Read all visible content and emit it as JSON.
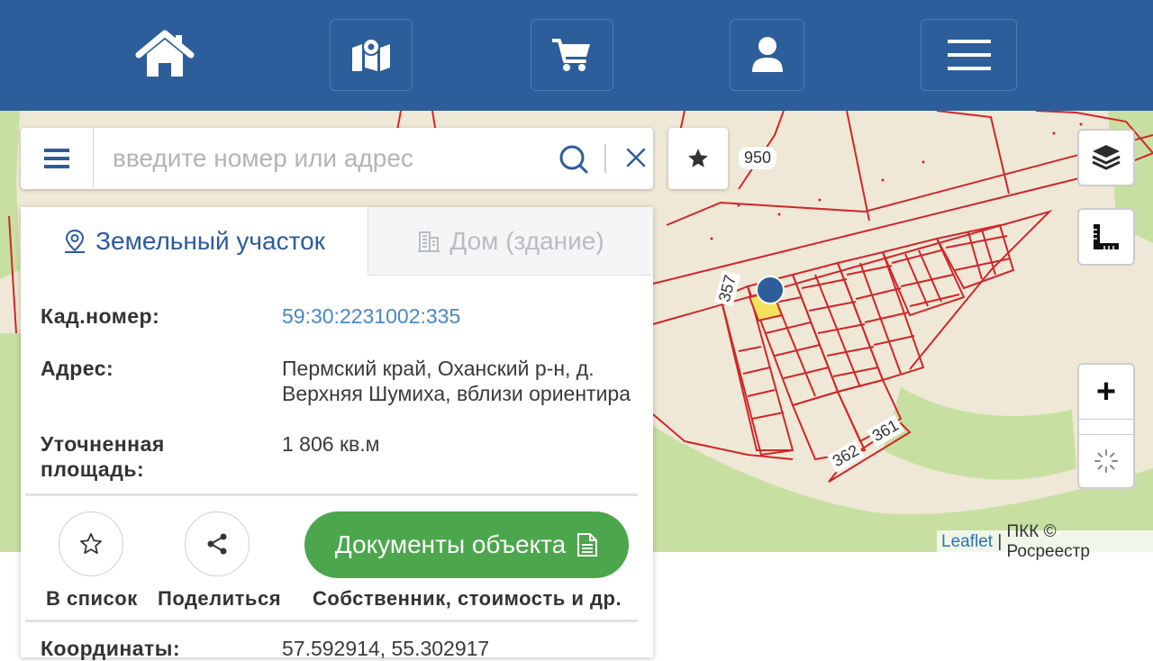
{
  "nav": {
    "items": [
      {
        "name": "home-icon"
      },
      {
        "name": "map-icon"
      },
      {
        "name": "cart-icon"
      },
      {
        "name": "user-icon"
      },
      {
        "name": "hamburger-menu-icon"
      }
    ],
    "bg_color": "#2c5e9b"
  },
  "search": {
    "placeholder": "введите номер или адрес"
  },
  "map": {
    "labels": {
      "parcel_950": "950",
      "parcel_357": "357",
      "parcel_361": "361",
      "parcel_362": "362"
    },
    "attribution": {
      "leaflet": "Leaflet",
      "sep": " | ",
      "rest": "ПКК © Росреестр"
    },
    "zoom_in": "+"
  },
  "panel": {
    "tabs": {
      "active": "Земельный участок",
      "inactive": "Дом (здание)"
    },
    "fields": {
      "cad_label": "Кад.номер:",
      "cad_value": "59:30:2231002:335",
      "address_label": "Адрес:",
      "address_line1": "Пермский край, Оханский р-н, д.",
      "address_line2": "Верхняя Шумиха, вблизи ориентира",
      "area_label_1": "Уточненная",
      "area_label_2": "площадь:",
      "area_value": "1 806 кв.м",
      "coords_label": "Координаты:",
      "coords_value": "57.592914, 55.302917"
    },
    "actions": {
      "add_list": "В список",
      "share": "Поделиться",
      "documents": "Документы объекта",
      "documents_sub": "Собственник, стоимость и др."
    }
  },
  "colors": {
    "accent": "#2c5e9b",
    "link": "#4a86c5",
    "green": "#4ca64c",
    "parcel_line": "#d0262a",
    "selected_parcel": "#f3e35a"
  }
}
